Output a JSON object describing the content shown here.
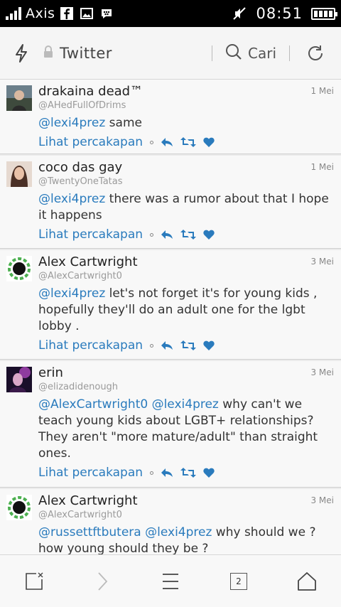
{
  "status_bar": {
    "carrier": "Axis",
    "time": "08:51"
  },
  "browser": {
    "title": "Twitter",
    "search_label": "Cari"
  },
  "colors": {
    "link": "#2a7bbd",
    "status_bg": "#000000",
    "reply_icon": "#2a7bbd",
    "retweet_icon": "#2a7bbd",
    "like_icon": "#2a7bbd"
  },
  "tweets": [
    {
      "name": "drakaina dead™",
      "handle": "@AHedFullOfDrims",
      "date": "1 Mei",
      "mentions": "@lexi4prez",
      "text": " same",
      "action_label": "Lihat percakapan"
    },
    {
      "name": "coco das gay",
      "handle": "@TwentyOneTatas",
      "date": "1 Mei",
      "mentions": "@lexi4prez",
      "text": " there was a rumor about that I hope it happens",
      "action_label": "Lihat percakapan"
    },
    {
      "name": "Alex Cartwright",
      "handle": "@AlexCartwright0",
      "date": "3 Mei",
      "mentions": "@lexi4prez",
      "text": " let's not forget it's for young kids , hopefully they'll do an adult one for the lgbt lobby .",
      "action_label": "Lihat percakapan"
    },
    {
      "name": "erin",
      "handle": "@elizadidenough",
      "date": "3 Mei",
      "mentions": "@AlexCartwright0 @lexi4prez",
      "text": " why can't we teach young kids about LGBT+ relationships? They aren't \"more mature/adult\" than straight ones.",
      "action_label": "Lihat percakapan"
    },
    {
      "name": "Alex Cartwright",
      "handle": "@AlexCartwright0",
      "date": "3 Mei",
      "mentions": "@russettftbutera @lexi4prez",
      "text": " why should we ? how young should they be ?",
      "action_label": ""
    }
  ],
  "bottom_bar": {
    "tab_count": "2"
  }
}
